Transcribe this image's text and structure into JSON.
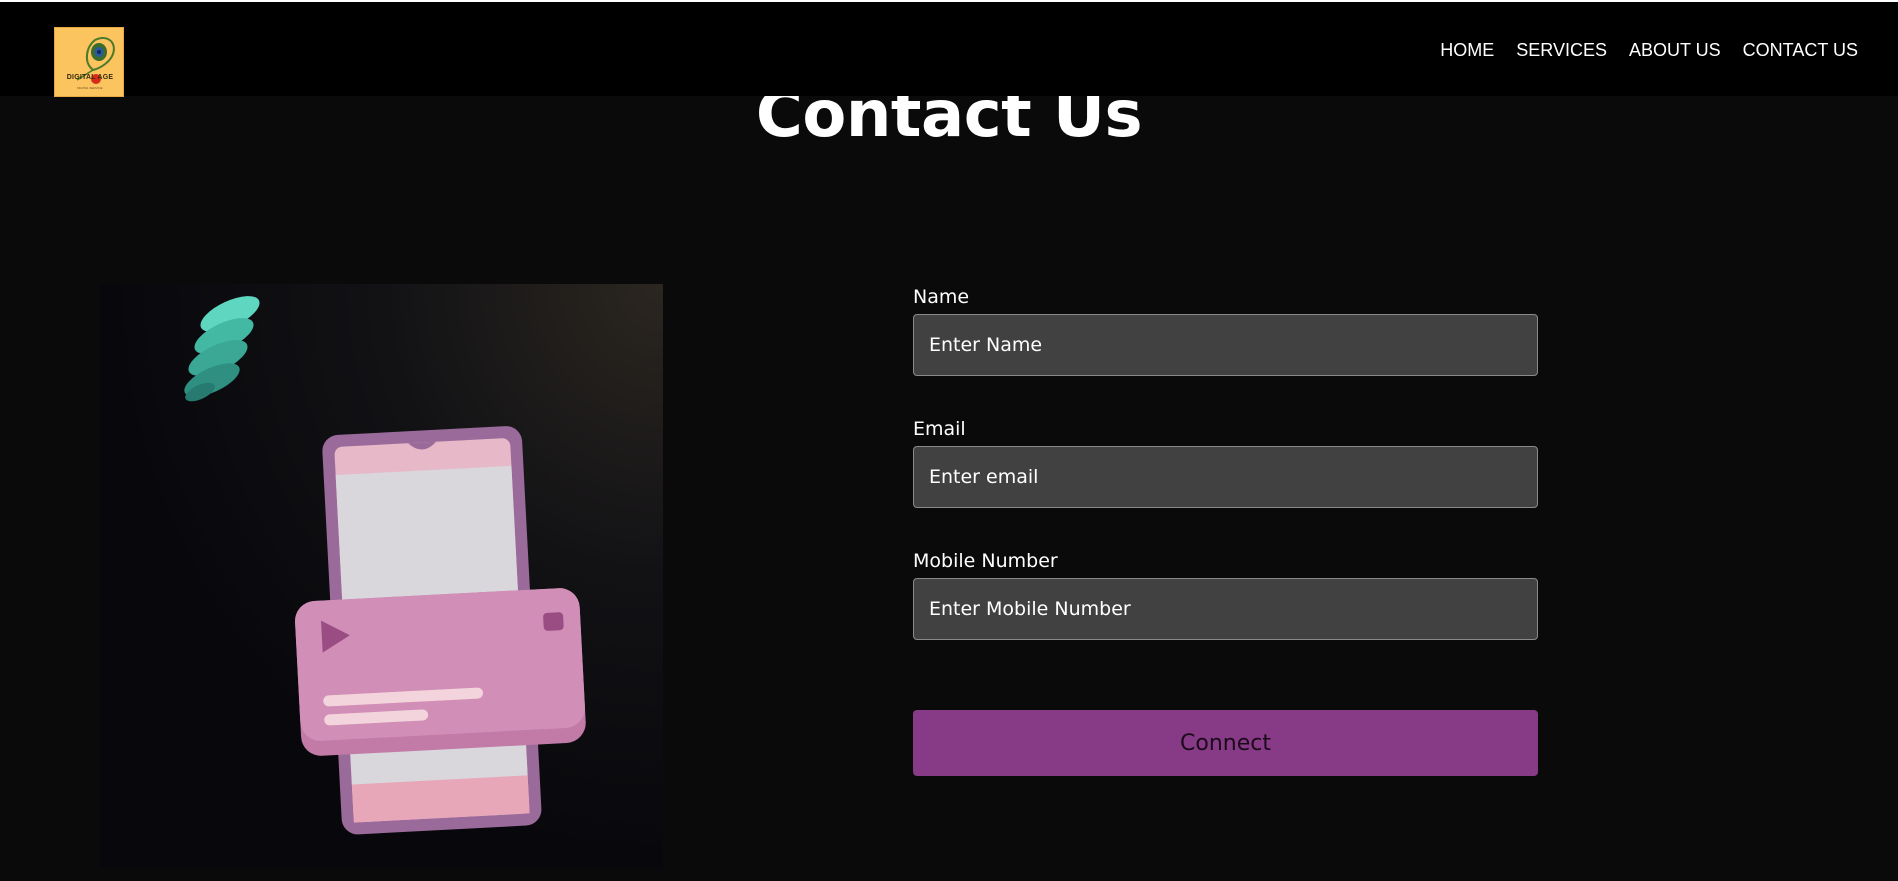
{
  "logo": {
    "text": "DIGITAL AGE",
    "subtext": "DIGITAL SERVICE",
    "icon": "peacock-feather-icon",
    "background": "#fbc45f"
  },
  "nav": {
    "items": [
      {
        "label": "HOME"
      },
      {
        "label": "SERVICES"
      },
      {
        "label": "ABOUT US"
      },
      {
        "label": "CONTACT US"
      }
    ]
  },
  "page": {
    "title": "Contact Us"
  },
  "illustration": {
    "icon": "phone-video-card-illustration",
    "colors": {
      "phone": "#a070a0",
      "card": "#c98bb5",
      "spring": "#4fc7b0"
    }
  },
  "form": {
    "name": {
      "label": "Name",
      "placeholder": "Enter Name",
      "value": ""
    },
    "email": {
      "label": "Email",
      "placeholder": "Enter email",
      "value": ""
    },
    "mobile": {
      "label": "Mobile Number",
      "placeholder": "Enter Mobile Number",
      "value": ""
    },
    "submit_label": "Connect"
  },
  "colors": {
    "background": "#0a0a0a",
    "navbar": "#000000",
    "input": "#414141",
    "button": "#873a86"
  }
}
